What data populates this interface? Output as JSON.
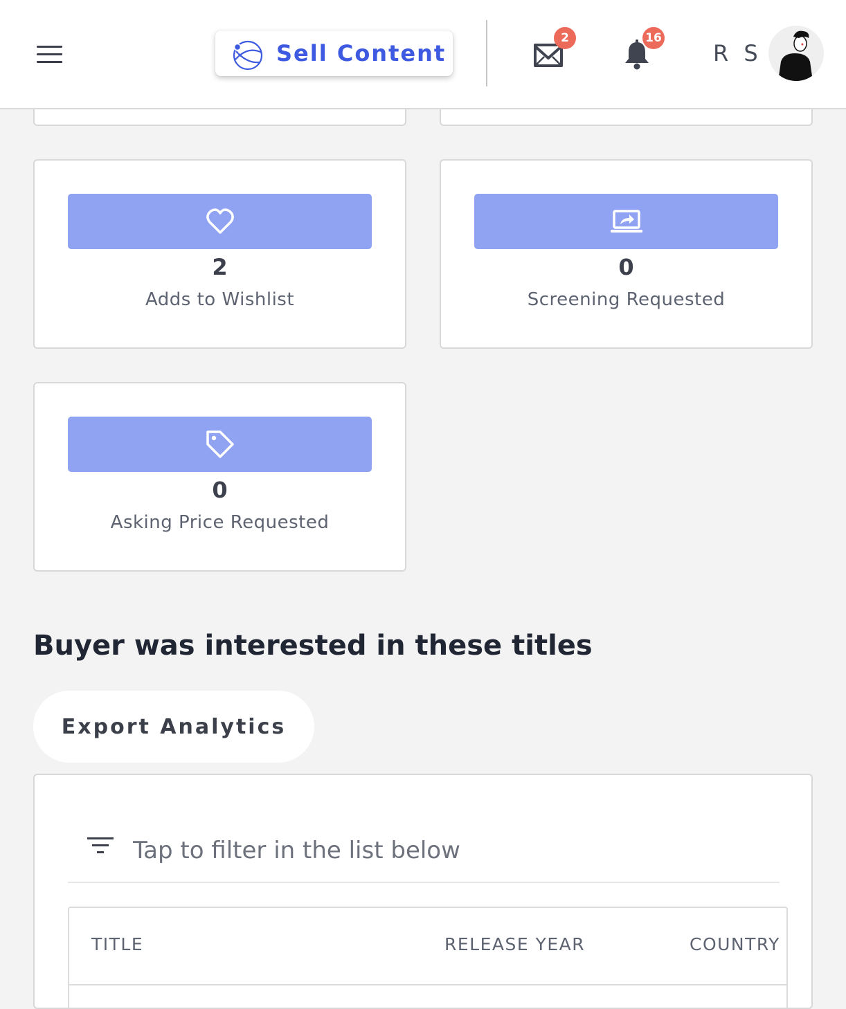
{
  "header": {
    "sell_button_label": "Sell Content",
    "messages_count": "2",
    "notifications_count": "16",
    "user_initials": "R S"
  },
  "stats": [
    {
      "icon": "heart-icon",
      "value": "2",
      "label": "Adds to Wishlist"
    },
    {
      "icon": "screen-share-icon",
      "value": "0",
      "label": "Screening Requested"
    },
    {
      "icon": "price-tag-icon",
      "value": "0",
      "label": "Asking Price Requested"
    }
  ],
  "section_heading": "Buyer was interested in these titles",
  "export_button_label": "Export Analytics",
  "filter": {
    "placeholder": "Tap to filter in the list below"
  },
  "table": {
    "columns": [
      "TITLE",
      "RELEASE YEAR",
      "COUNTRY"
    ]
  },
  "colors": {
    "accent": "#3d5ae0",
    "stat_bar": "#8fa3f2",
    "badge": "#ec6a5a",
    "page_bg": "#f3f3f3"
  }
}
